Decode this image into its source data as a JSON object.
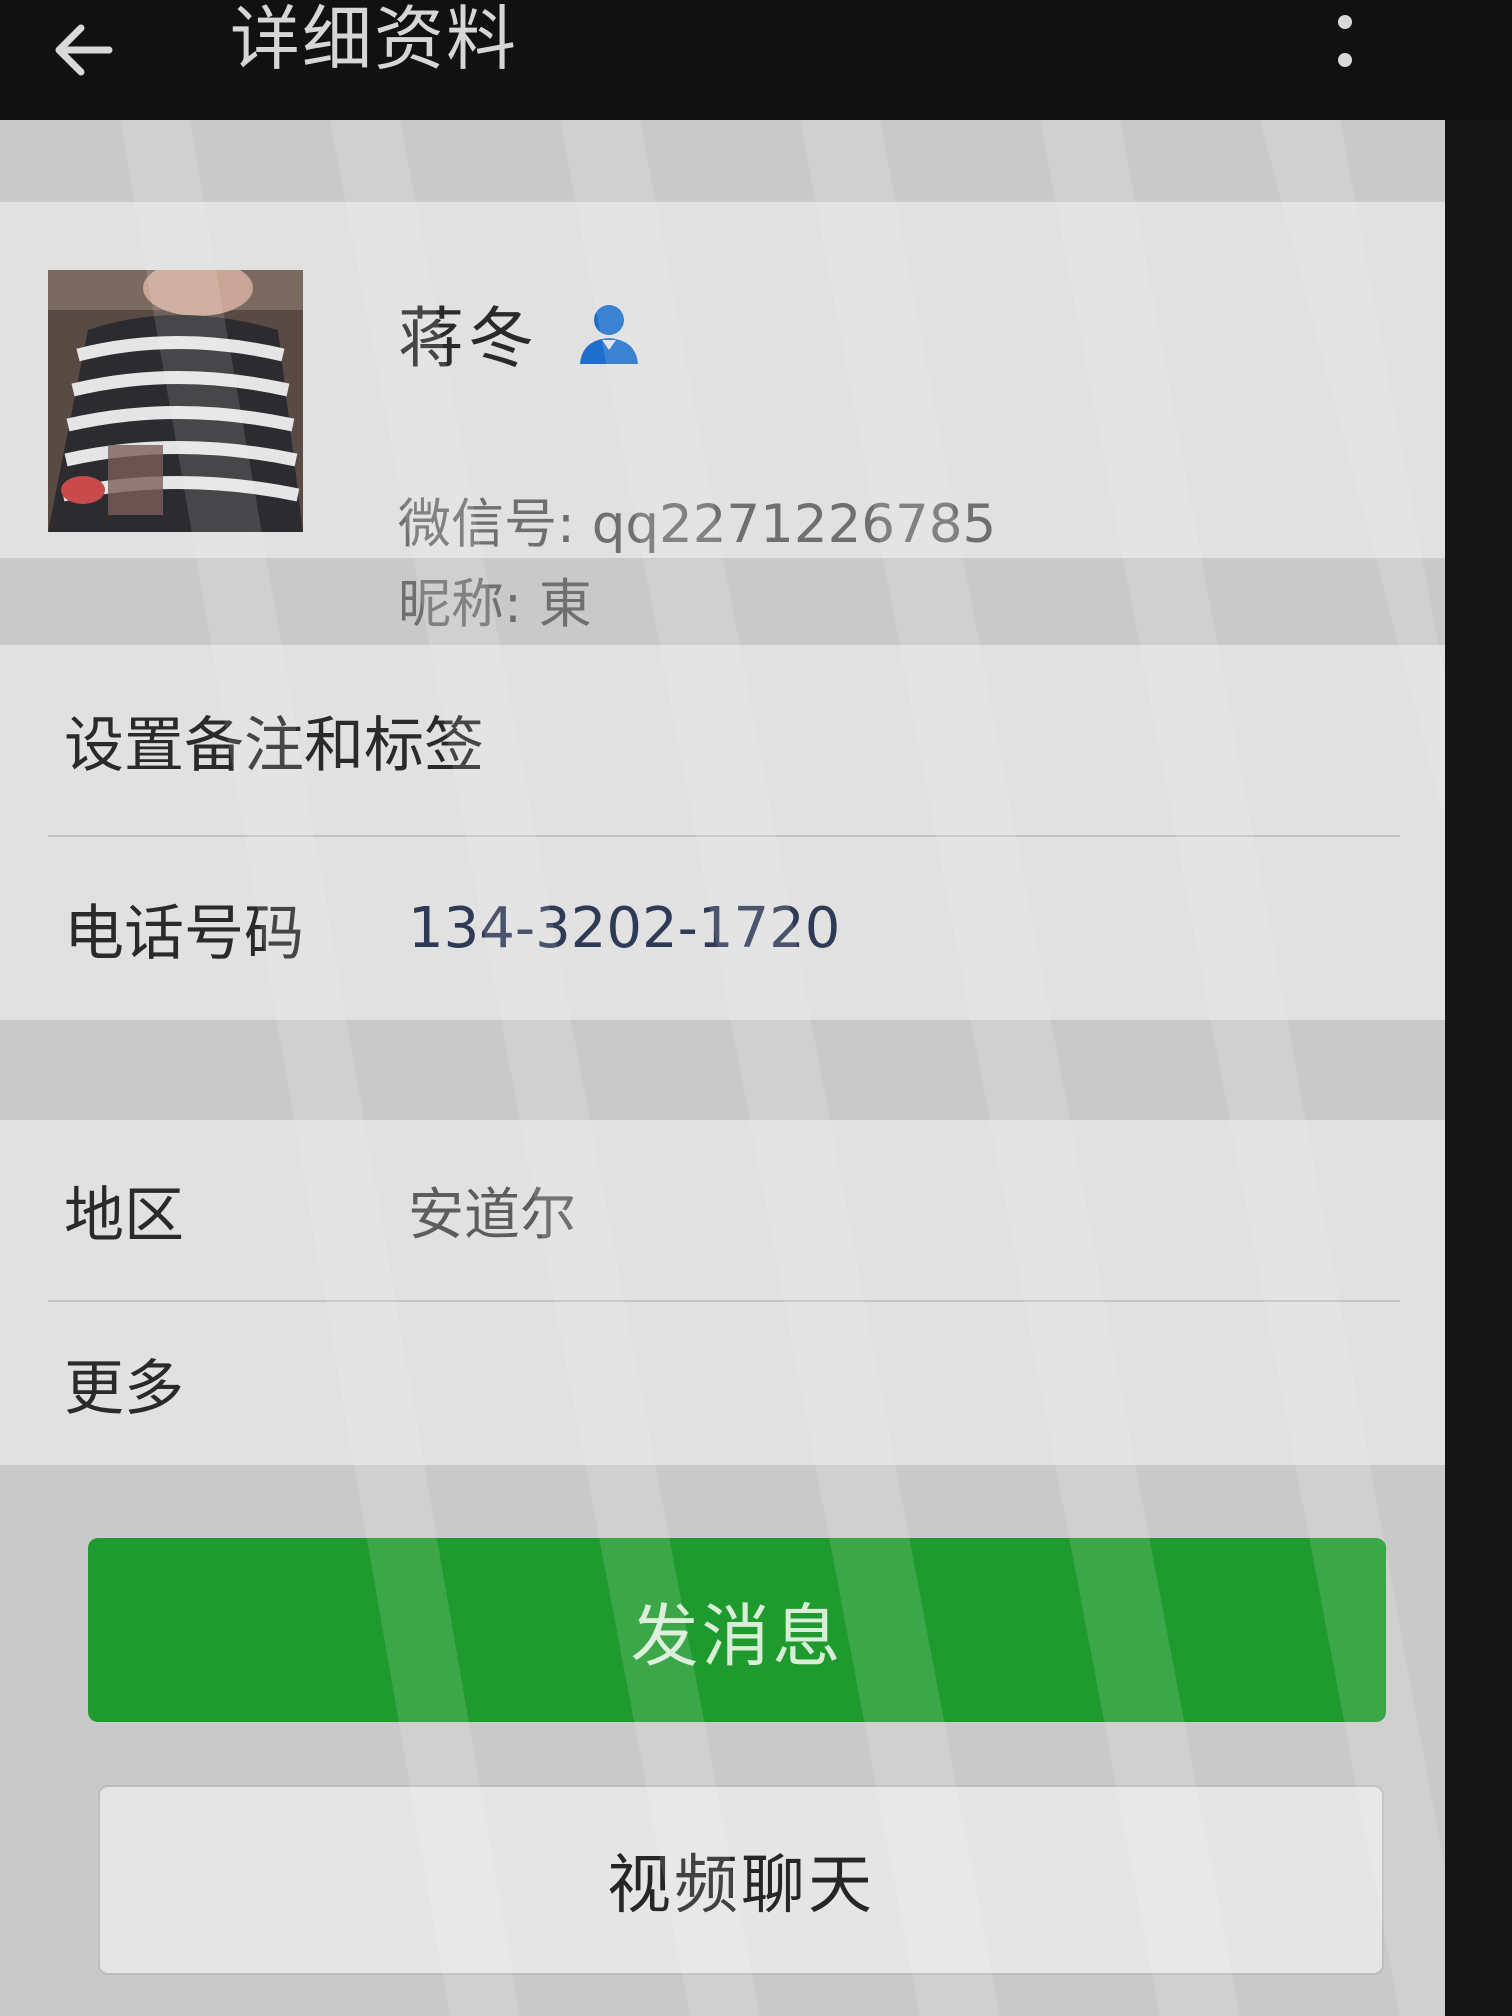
{
  "window": {
    "title": "详细资料",
    "back_icon": "arrow-left-icon",
    "menu_icon": "more-vertical-icon"
  },
  "profile": {
    "name": "蒋冬",
    "contact_icon": "person-icon",
    "wechat_id": "微信号: qq2271226785",
    "nickname": "昵称: 東"
  },
  "settings": {
    "remark_label": "设置备注和标签",
    "phone_label": "电话号码",
    "phone_value": "134-3202-1720"
  },
  "info": {
    "region_label": "地区",
    "region_value": "安道尔",
    "more_label": "更多"
  },
  "actions": {
    "send_message_label": "发消息",
    "video_chat_label": "视频聊天"
  },
  "colors": {
    "accent": "#1f9a2e",
    "contact_icon": "#1e6fcc"
  }
}
